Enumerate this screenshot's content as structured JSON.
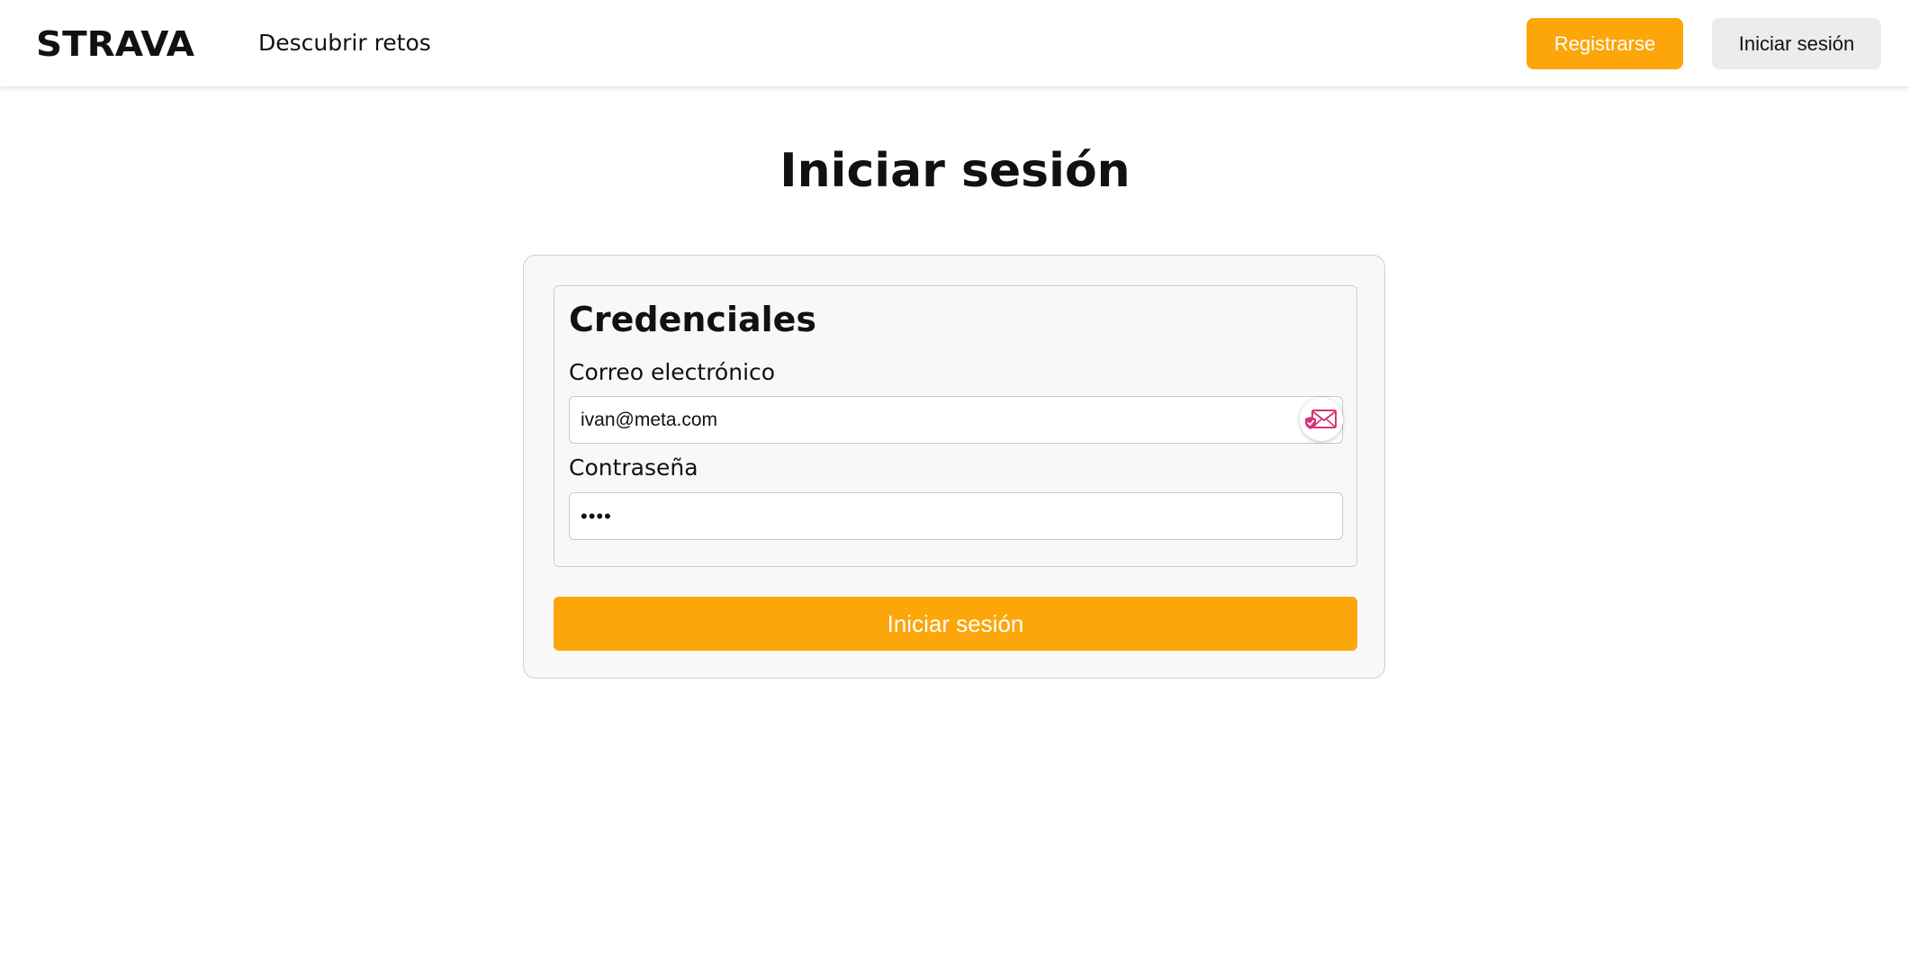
{
  "brand": {
    "logo_text": "STRAVA",
    "accent_color": "#fca60a"
  },
  "header": {
    "nav_link": "Descubrir retos",
    "register_label": "Registrarse",
    "login_label": "Iniciar sesión"
  },
  "page": {
    "title": "Iniciar sesión"
  },
  "form": {
    "legend": "Credenciales",
    "email_label": "Correo electrónico",
    "email_value": "ivan@meta.com",
    "password_label": "Contraseña",
    "password_value": "abcd",
    "autofill_icon": "secure-mail-icon",
    "submit_label": "Iniciar sesión"
  }
}
